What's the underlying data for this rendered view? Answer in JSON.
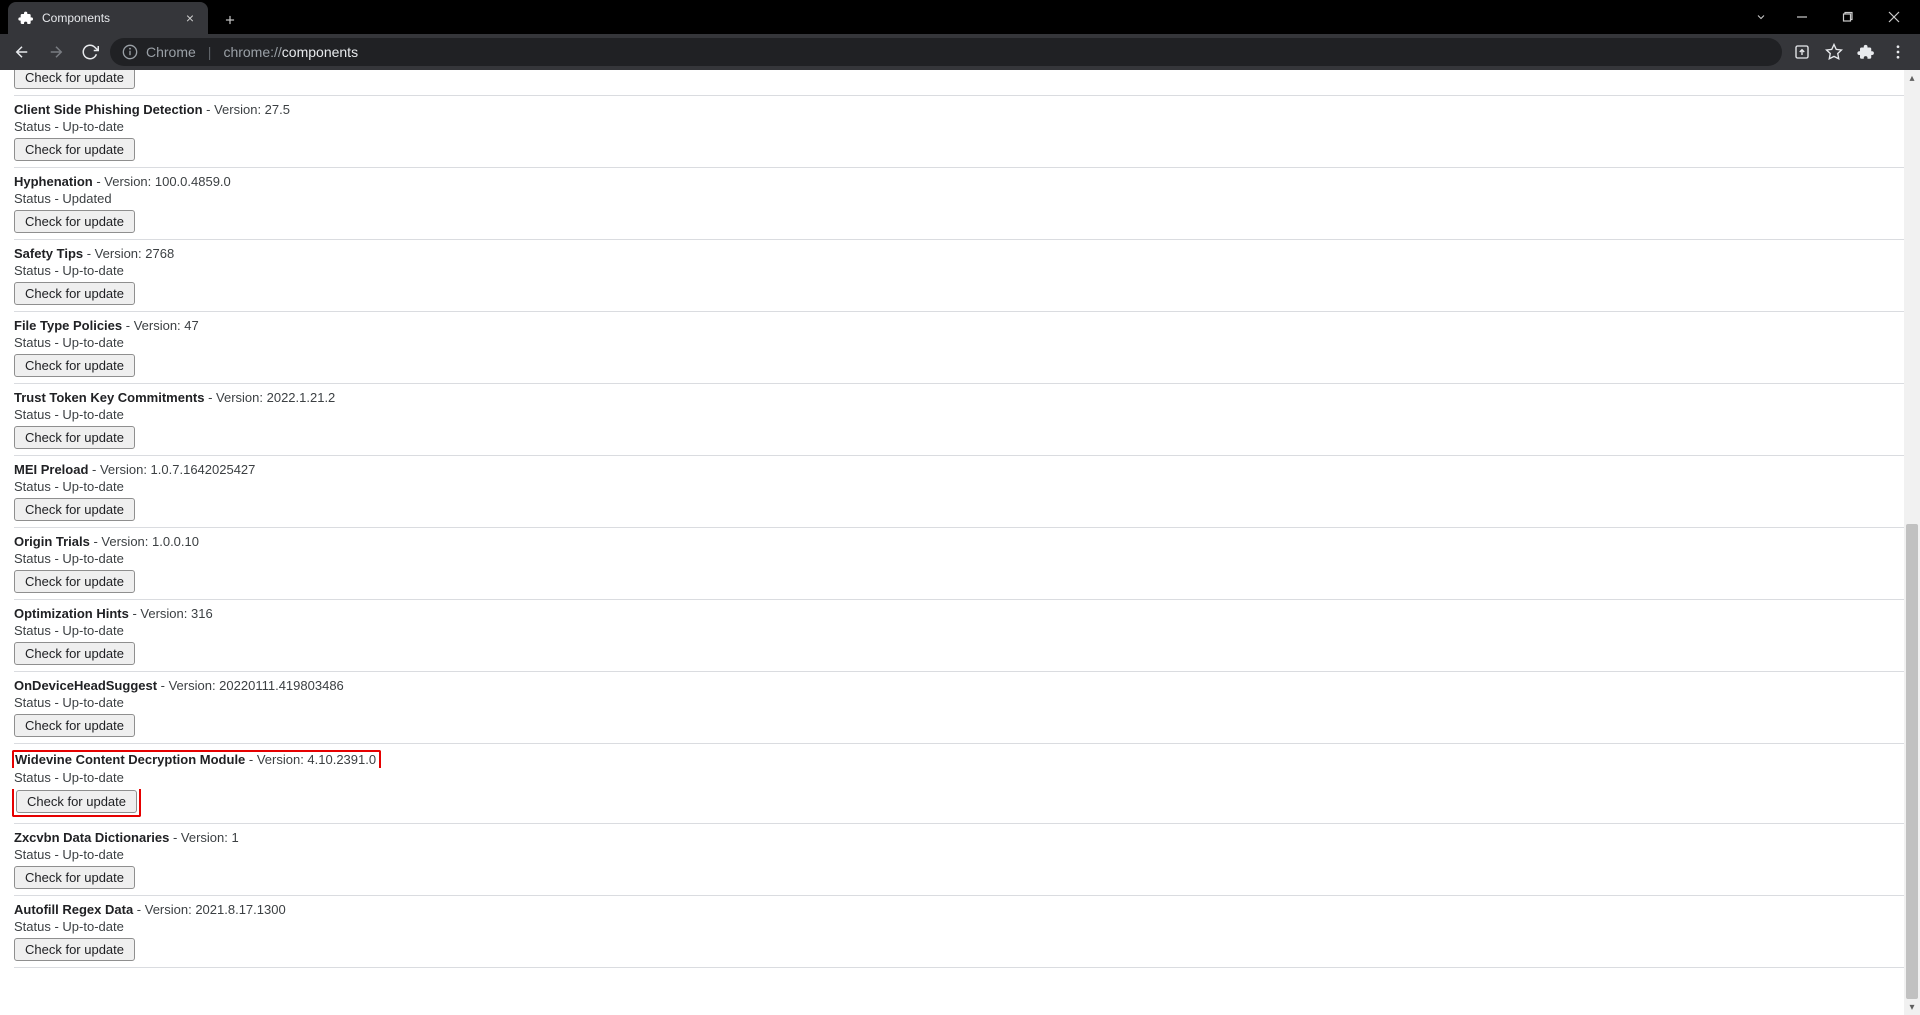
{
  "window": {
    "tab_title": "Components",
    "new_tab_label": "+",
    "close_tab_label": "×"
  },
  "toolbar": {
    "url_host": "Chrome",
    "url_protocol": "chrome://",
    "url_path": "components"
  },
  "labels": {
    "version_prefix": " - Version: ",
    "status_prefix": "Status - ",
    "check_button": "Check for update"
  },
  "scrollbar": {
    "thumb_top_pct": 48,
    "thumb_height_pct": 52
  },
  "components": [
    {
      "name": "",
      "version": "",
      "status": "",
      "partial_top": true
    },
    {
      "name": "Client Side Phishing Detection",
      "version": "27.5",
      "status": "Up-to-date"
    },
    {
      "name": "Hyphenation",
      "version": "100.0.4859.0",
      "status": "Updated"
    },
    {
      "name": "Safety Tips",
      "version": "2768",
      "status": "Up-to-date"
    },
    {
      "name": "File Type Policies",
      "version": "47",
      "status": "Up-to-date"
    },
    {
      "name": "Trust Token Key Commitments",
      "version": "2022.1.21.2",
      "status": "Up-to-date"
    },
    {
      "name": "MEI Preload",
      "version": "1.0.7.1642025427",
      "status": "Up-to-date"
    },
    {
      "name": "Origin Trials",
      "version": "1.0.0.10",
      "status": "Up-to-date"
    },
    {
      "name": "Optimization Hints",
      "version": "316",
      "status": "Up-to-date"
    },
    {
      "name": "OnDeviceHeadSuggest",
      "version": "20220111.419803486",
      "status": "Up-to-date"
    },
    {
      "name": "Widevine Content Decryption Module",
      "version": "4.10.2391.0",
      "status": "Up-to-date",
      "highlight": true
    },
    {
      "name": "Zxcvbn Data Dictionaries",
      "version": "1",
      "status": "Up-to-date"
    },
    {
      "name": "Autofill Regex Data",
      "version": "2021.8.17.1300",
      "status": "Up-to-date"
    }
  ]
}
